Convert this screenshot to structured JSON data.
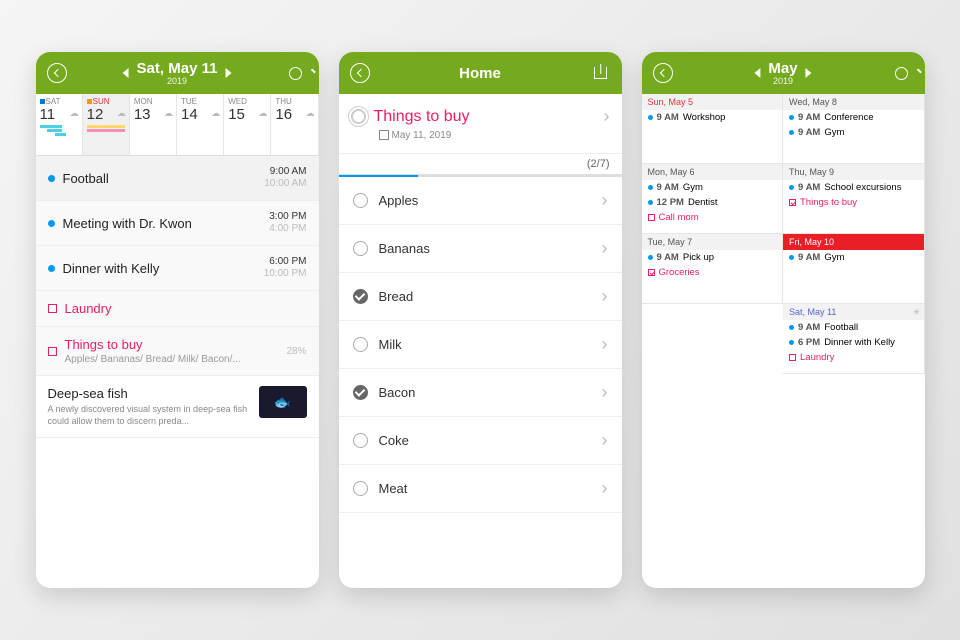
{
  "p1": {
    "title": "Sat, May 11",
    "year": "2019",
    "days": [
      {
        "dow": "SAT",
        "num": "11",
        "cls": "sat"
      },
      {
        "dow": "SUN",
        "num": "12",
        "cls": "sunday"
      },
      {
        "dow": "MON",
        "num": "13"
      },
      {
        "dow": "TUE",
        "num": "14"
      },
      {
        "dow": "WED",
        "num": "15"
      },
      {
        "dow": "THU",
        "num": "16"
      }
    ],
    "events": [
      {
        "title": "Football",
        "t1": "9:00 AM",
        "t2": "10:00 AM"
      },
      {
        "title": "Meeting with Dr. Kwon",
        "t1": "3:00 PM",
        "t2": "4:00 PM"
      },
      {
        "title": "Dinner with Kelly",
        "t1": "6:00 PM",
        "t2": "10:00 PM"
      }
    ],
    "tasks": [
      {
        "title": "Laundry"
      },
      {
        "title": "Things to buy",
        "sub": "Apples/ Bananas/ Bread/ Milk/ Bacon/...",
        "pct": "28%"
      }
    ],
    "news": {
      "title": "Deep-sea fish",
      "body": "A newly discovered visual system in deep-sea fish could allow them to discern preda..."
    }
  },
  "p2": {
    "title": "Home",
    "listTitle": "Things to buy",
    "listDate": "May 11, 2019",
    "count": "(2/7)",
    "items": [
      {
        "label": "Apples",
        "done": false
      },
      {
        "label": "Bananas",
        "done": false
      },
      {
        "label": "Bread",
        "done": true
      },
      {
        "label": "Milk",
        "done": false
      },
      {
        "label": "Bacon",
        "done": true
      },
      {
        "label": "Coke",
        "done": false
      },
      {
        "label": "Meat",
        "done": false
      }
    ]
  },
  "p3": {
    "title": "May",
    "year": "2019",
    "cells": [
      {
        "head": "Sun, May 5",
        "cls": "sun",
        "ev": [
          {
            "t": "9 AM",
            "txt": "Workshop"
          }
        ]
      },
      {
        "head": "Wed, May 8",
        "ev": [
          {
            "t": "9 AM",
            "txt": "Conference"
          },
          {
            "t": "9 AM",
            "txt": "Gym"
          }
        ]
      },
      {
        "head": "Mon, May 6",
        "ev": [
          {
            "t": "9 AM",
            "txt": "Gym"
          },
          {
            "t": "12 PM",
            "txt": "Dentist"
          },
          {
            "task": "Call mom"
          }
        ]
      },
      {
        "head": "Thu, May 9",
        "ev": [
          {
            "t": "9 AM",
            "txt": "School excursions"
          },
          {
            "taskdone": "Things to buy"
          }
        ]
      },
      {
        "head": "Tue, May 7",
        "ev": [
          {
            "t": "9 AM",
            "txt": "Pick up"
          },
          {
            "taskdone": "Groceries"
          }
        ]
      },
      {
        "head": "Fri, May 10",
        "cls": "today",
        "ev": [
          {
            "t": "9 AM",
            "txt": "Gym"
          }
        ]
      },
      {
        "head": "",
        "empty": true
      },
      {
        "head": "Sat, May 11",
        "cls": "sat",
        "ev": [
          {
            "t": "9 AM",
            "txt": "Football"
          },
          {
            "t": "6 PM",
            "txt": "Dinner with Kelly"
          },
          {
            "task": "Laundry"
          }
        ]
      }
    ]
  }
}
